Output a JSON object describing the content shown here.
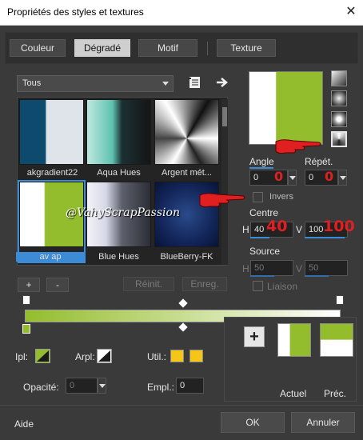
{
  "window": {
    "title": "Propriétés des styles et textures",
    "close_symbol": "✕"
  },
  "tabs": [
    {
      "label": "Couleur",
      "active": false
    },
    {
      "label": "Dégradé",
      "active": true
    },
    {
      "label": "Motif",
      "active": false
    },
    {
      "label": "Texture",
      "active": false
    }
  ],
  "category_select": {
    "value": "Tous"
  },
  "gallery": {
    "items": [
      {
        "label": "akgradient22",
        "colors": [
          "#0d4a6e",
          "#dfe4ea"
        ]
      },
      {
        "label": "Aqua Hues",
        "colors": [
          "#9fdad0",
          "#1a1a1a"
        ]
      },
      {
        "label": "Argent mét...",
        "colors": [
          "#ffffff",
          "#222222"
        ]
      },
      {
        "label": "av ap",
        "colors": [
          "#ffffff",
          "#93bd2c"
        ],
        "selected": true
      },
      {
        "label": "Blue Hues",
        "colors": [
          "#f2f2f7",
          "#3c3f4a"
        ]
      },
      {
        "label": "BlueBerry-FK",
        "colors": [
          "#0c1e4f",
          "#2a4b8a"
        ]
      }
    ],
    "watermark": "@VahyScrapPassion"
  },
  "gallery_buttons": {
    "add": "+",
    "remove": "-",
    "reset": "Réinit.",
    "save": "Enreg."
  },
  "angle": {
    "label": "Angle",
    "value": "0",
    "annotation": "0"
  },
  "repeat": {
    "label": "Répét.",
    "value": "0",
    "annotation": "0"
  },
  "invert": {
    "label": "Invers",
    "checked": false
  },
  "centre": {
    "label": "Centre",
    "h_label": "H",
    "h_value": "40",
    "h_annotation": "40",
    "v_label": "V",
    "v_value": "100",
    "v_annotation": "100"
  },
  "source": {
    "label": "Source",
    "h_label": "H",
    "h_value": "50",
    "v_label": "V",
    "v_value": "50"
  },
  "link": {
    "label": "Liaison",
    "checked": false
  },
  "gradient": {
    "colors": [
      "#93bd2c",
      "#ffffff"
    ]
  },
  "stops": {
    "ipl_label": "Ipl:",
    "arpl_label": "Arpl:",
    "util_label": "Util.:",
    "util_color": "#f5c518",
    "opacity_label": "Opacité:",
    "opacity_value": "0",
    "empl_label": "Empl.:",
    "empl_value": "0"
  },
  "preview": {
    "add_symbol": "+",
    "current_label": "Actuel",
    "previous_label": "Préc."
  },
  "footer": {
    "help": "Aide",
    "ok": "OK",
    "cancel": "Annuler"
  },
  "colors": {
    "accent": "#3b8bd6",
    "gradient_green": "#93bd2c",
    "annotation_red": "#e02020"
  }
}
